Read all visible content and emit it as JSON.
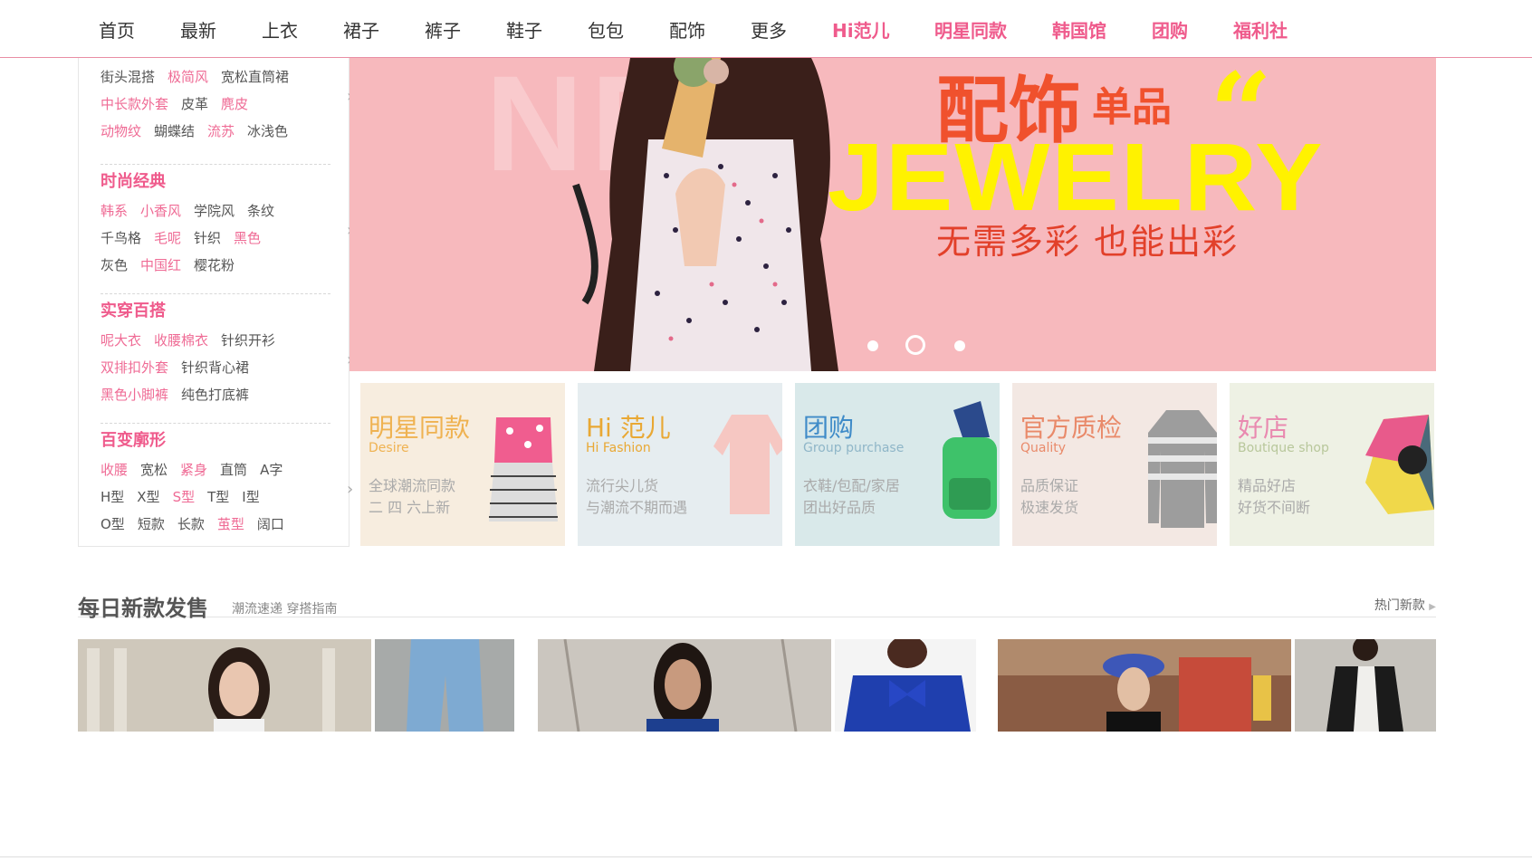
{
  "nav": {
    "items": [
      {
        "label": "首页",
        "hot": false
      },
      {
        "label": "最新",
        "hot": false
      },
      {
        "label": "上衣",
        "hot": false
      },
      {
        "label": "裙子",
        "hot": false
      },
      {
        "label": "裤子",
        "hot": false
      },
      {
        "label": "鞋子",
        "hot": false
      },
      {
        "label": "包包",
        "hot": false
      },
      {
        "label": "配饰",
        "hot": false
      },
      {
        "label": "更多",
        "hot": false
      },
      {
        "label": "Hi范儿",
        "hot": true
      },
      {
        "label": "明星同款",
        "hot": true
      },
      {
        "label": "韩国馆",
        "hot": true
      },
      {
        "label": "团购",
        "hot": true
      },
      {
        "label": "福利社",
        "hot": true
      }
    ]
  },
  "categories": {
    "group0": {
      "rows": [
        [
          {
            "t": "街头混搭",
            "p": false
          },
          {
            "t": "极简风",
            "p": true
          },
          {
            "t": "宽松直筒裙",
            "p": false
          }
        ],
        [
          {
            "t": "中长款外套",
            "p": true
          },
          {
            "t": "皮革",
            "p": false
          },
          {
            "t": "麂皮",
            "p": true
          }
        ],
        [
          {
            "t": "动物纹",
            "p": true
          },
          {
            "t": "蝴蝶结",
            "p": false
          },
          {
            "t": "流苏",
            "p": true
          },
          {
            "t": "冰浅色",
            "p": false
          }
        ]
      ]
    },
    "group1": {
      "title": "时尚经典",
      "rows": [
        [
          {
            "t": "韩系",
            "p": true
          },
          {
            "t": "小香风",
            "p": true
          },
          {
            "t": "学院风",
            "p": false
          },
          {
            "t": "条纹",
            "p": false
          }
        ],
        [
          {
            "t": "千鸟格",
            "p": false
          },
          {
            "t": "毛呢",
            "p": true
          },
          {
            "t": "针织",
            "p": false
          },
          {
            "t": "黑色",
            "p": true
          }
        ],
        [
          {
            "t": "灰色",
            "p": false
          },
          {
            "t": "中国红",
            "p": true
          },
          {
            "t": "樱花粉",
            "p": false
          }
        ]
      ]
    },
    "group2": {
      "title": "实穿百搭",
      "rows": [
        [
          {
            "t": "呢大衣",
            "p": true
          },
          {
            "t": "收腰棉衣",
            "p": true
          },
          {
            "t": "针织开衫",
            "p": false
          }
        ],
        [
          {
            "t": "双排扣外套",
            "p": true
          },
          {
            "t": "针织背心裙",
            "p": false
          }
        ],
        [
          {
            "t": "黑色小脚裤",
            "p": true
          },
          {
            "t": "纯色打底裤",
            "p": false
          }
        ]
      ]
    },
    "group3": {
      "title": "百变廓形",
      "rows": [
        [
          {
            "t": "收腰",
            "p": true
          },
          {
            "t": "宽松",
            "p": false
          },
          {
            "t": "紧身",
            "p": true
          },
          {
            "t": "直筒",
            "p": false
          },
          {
            "t": "A字",
            "p": false
          }
        ],
        [
          {
            "t": "H型",
            "p": false
          },
          {
            "t": "X型",
            "p": false
          },
          {
            "t": "S型",
            "p": true
          },
          {
            "t": "T型",
            "p": false
          },
          {
            "t": "I型",
            "p": false
          }
        ],
        [
          {
            "t": "O型",
            "p": false
          },
          {
            "t": "短款",
            "p": false
          },
          {
            "t": "长款",
            "p": false
          },
          {
            "t": "茧型",
            "p": true
          },
          {
            "t": "阔口",
            "p": false
          }
        ]
      ]
    }
  },
  "banner": {
    "bg_text": "NEW",
    "title_cn": "配饰",
    "title_cn_small": "单品",
    "quote": "“",
    "title_en": "JEWELRY",
    "slogan": "无需多彩 也能出彩",
    "active_slide": 2,
    "slide_count": 3
  },
  "cards": [
    {
      "title": "明星同款",
      "sub": "Desire",
      "d1": "全球潮流同款",
      "d2": "二 四 六上新",
      "bg": "#f7eddf",
      "tc": "#efb251",
      "sc": "#efb251"
    },
    {
      "title": "Hi 范儿",
      "sub": "Hi Fashion",
      "d1": "流行尖儿货",
      "d2": "与潮流不期而遇",
      "bg": "#e6edf0",
      "tc": "#e9a834",
      "sc": "#e9a834"
    },
    {
      "title": "团购",
      "sub": "Group purchase",
      "d1": "衣鞋/包配/家居",
      "d2": "团出好品质",
      "bg": "#d9e9ea",
      "tc": "#3f8bc8",
      "sc": "#8fb6c8"
    },
    {
      "title": "官方质检",
      "sub": "Quality",
      "d1": "品质保证",
      "d2": "极速发货",
      "bg": "#f3e8e3",
      "tc": "#e98a6a",
      "sc": "#e98a6a"
    },
    {
      "title": "好店",
      "sub": "Boutique shop",
      "d1": "精品好店",
      "d2": "好货不间断",
      "bg": "#eef1e4",
      "tc": "#e98ab0",
      "sc": "#b8c79b"
    }
  ],
  "daily": {
    "title": "每日新款发售",
    "subtitle": "潮流速递 穿搭指南",
    "more": "热门新款"
  },
  "colors": {
    "accent_pink": "#ef5b8c",
    "banner_bg": "#f7b9bd",
    "jewelry_yellow": "#fff200",
    "title_orange": "#f0512d"
  }
}
